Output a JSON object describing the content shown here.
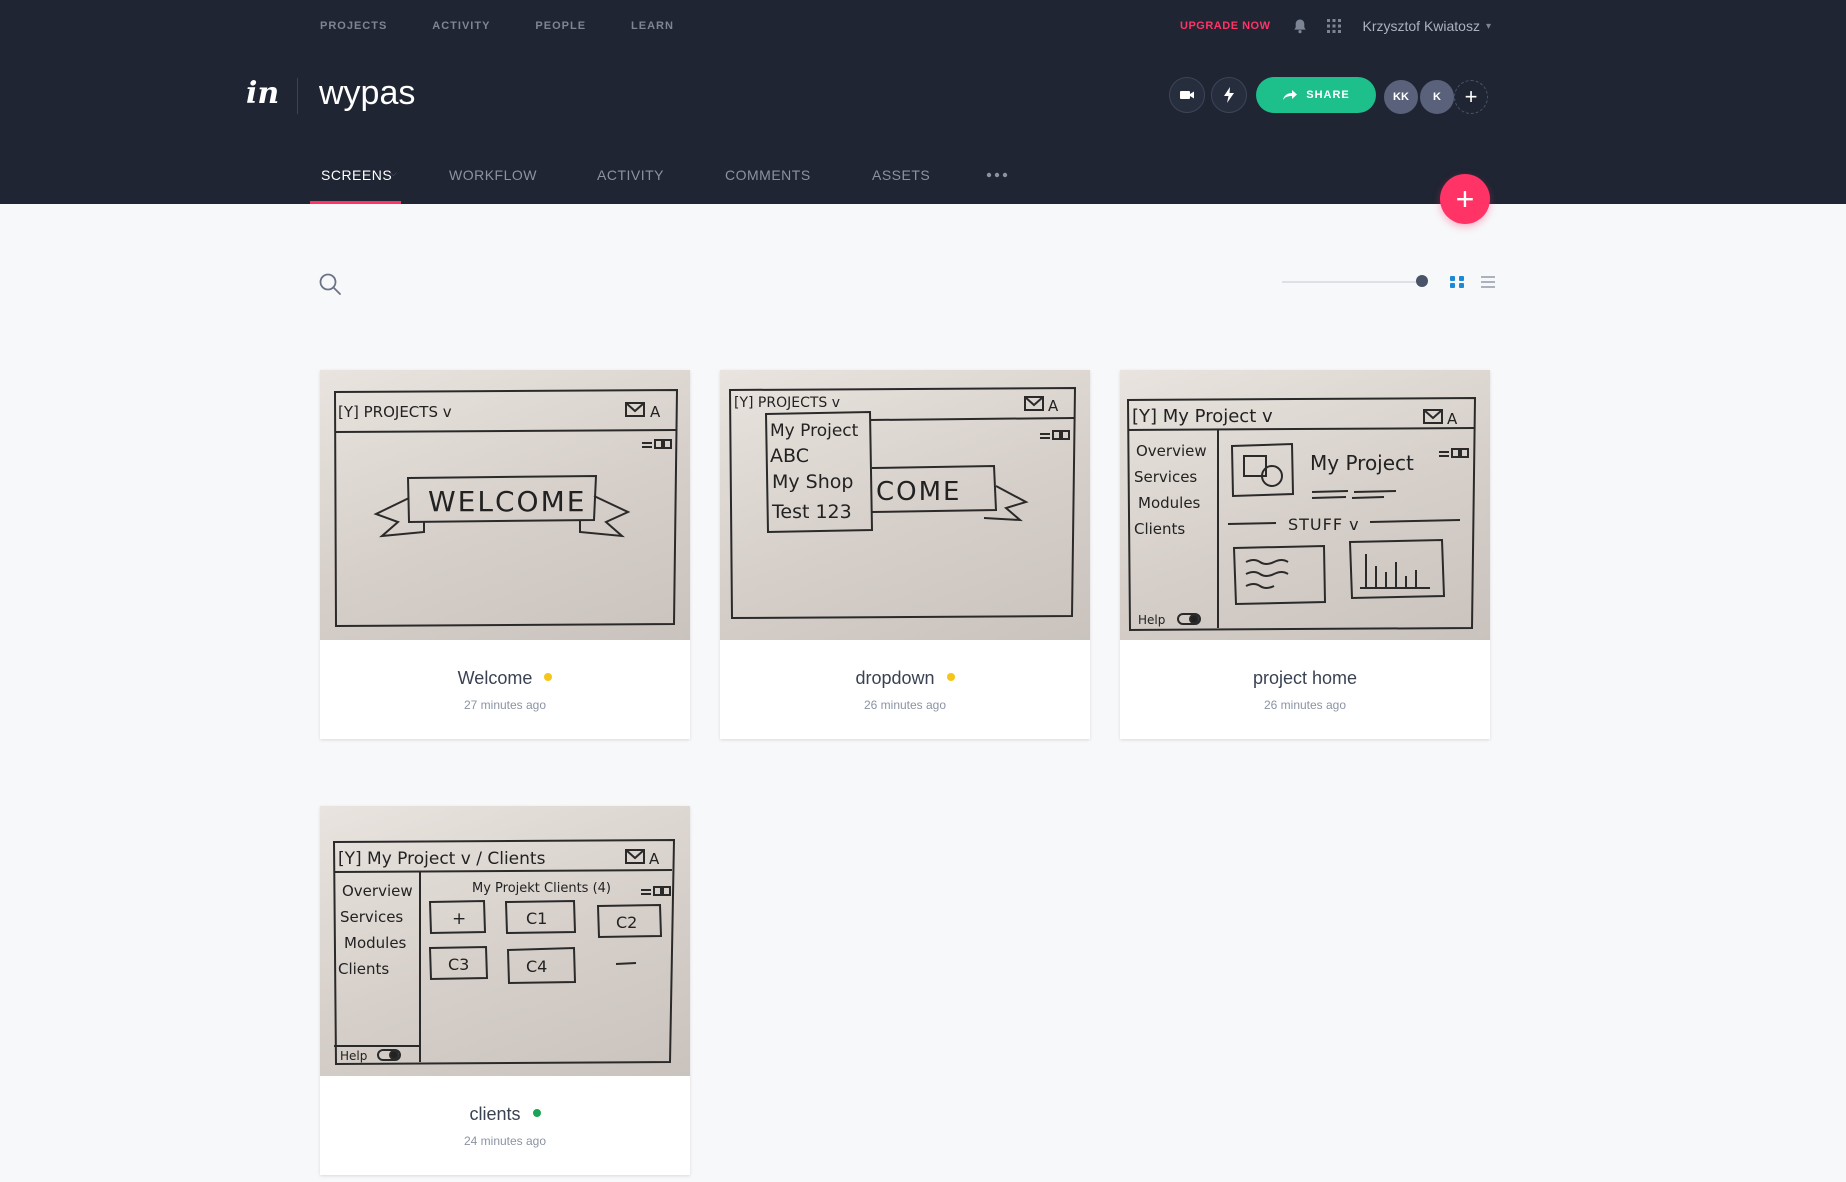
{
  "topnav": [
    "PROJECTS",
    "ACTIVITY",
    "PEOPLE",
    "LEARN"
  ],
  "upgrade_label": "UPGRADE NOW",
  "user_name": "Krzysztof Kwiatosz",
  "logo_text": "in",
  "project_title": "wypas",
  "share_label": "SHARE",
  "avatars": [
    "KK",
    "K"
  ],
  "tabs": [
    "SCREENS",
    "WORKFLOW",
    "ACTIVITY",
    "COMMENTS",
    "ASSETS"
  ],
  "colors": {
    "header_bg": "#1f2533",
    "accent_pink": "#ff3366",
    "share_green": "#1dbf8a",
    "status_yellow": "#f5c518",
    "status_green": "#1da355"
  },
  "screens": [
    {
      "title": "Welcome",
      "time": "27 minutes ago",
      "status": "yellow",
      "sketch": {
        "top": "[Y] PROJECTS v",
        "banner": "WELCOME"
      }
    },
    {
      "title": "dropdown",
      "time": "26 minutes ago",
      "status": "yellow",
      "sketch": {
        "top": "[Y] PROJECTS v",
        "menu": [
          "My Project",
          "ABC",
          "My Shop",
          "Test 123"
        ],
        "banner": "COME"
      }
    },
    {
      "title": "project home",
      "time": "26 minutes ago",
      "status": "",
      "sketch": {
        "top": "[Y] My Project v",
        "side": [
          "Overview",
          "Services",
          "Modules",
          "Clients"
        ],
        "heading": "My Project",
        "section": "STUFF v",
        "help": "Help"
      }
    },
    {
      "title": "clients",
      "time": "24 minutes ago",
      "status": "green",
      "sketch": {
        "top": "[Y] My Project v / Clients",
        "side": [
          "Overview",
          "Services",
          "Modules",
          "Clients"
        ],
        "heading": "My Projekt Clients (4)",
        "tiles": [
          "+",
          "C1",
          "C2",
          "C3",
          "C4"
        ],
        "help": "Help"
      }
    }
  ]
}
